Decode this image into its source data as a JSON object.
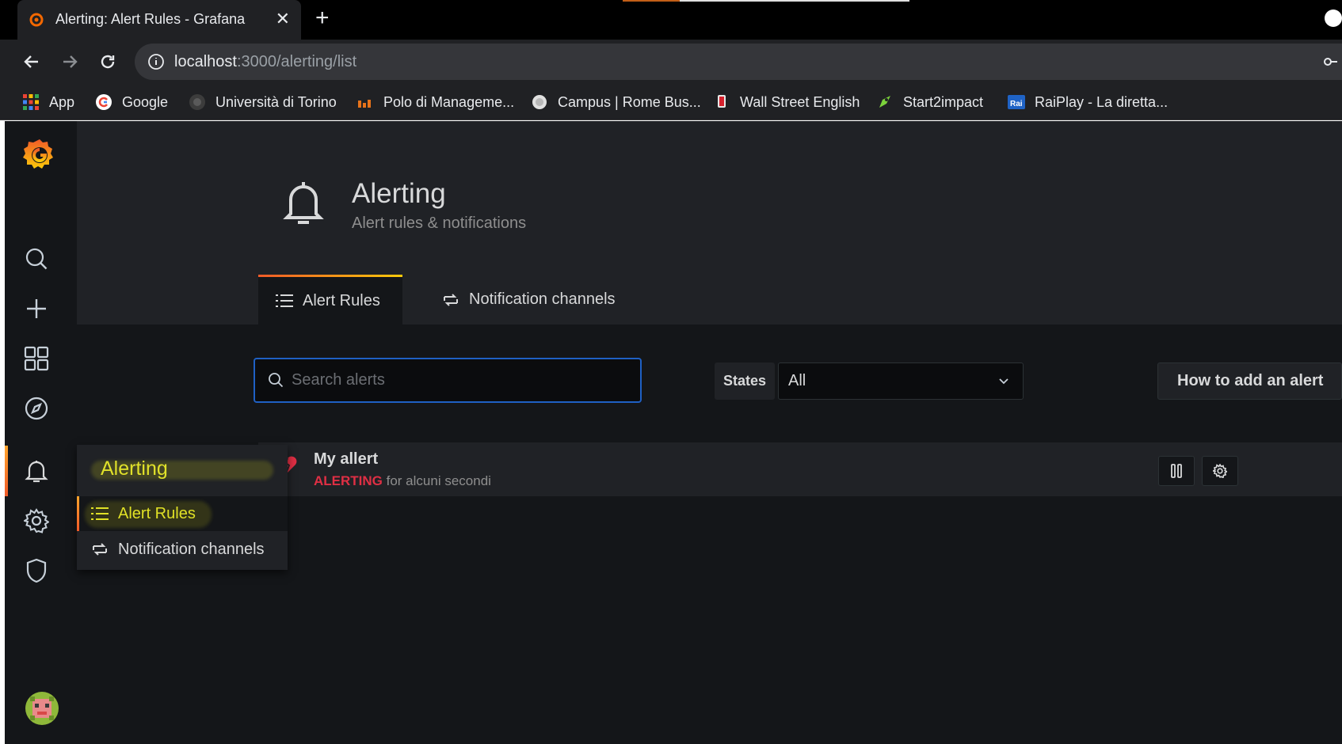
{
  "browser": {
    "tab_title": "Alerting: Alert Rules - Grafana",
    "url_host": "localhost",
    "url_path": ":3000/alerting/list",
    "bookmarks": [
      {
        "label": "App",
        "icon": "apps-grid-icon"
      },
      {
        "label": "Google",
        "icon": "google-icon"
      },
      {
        "label": "Università di Torino",
        "icon": "unito-icon"
      },
      {
        "label": "Polo di Manageme...",
        "icon": "polo-icon"
      },
      {
        "label": "Campus | Rome Bus...",
        "icon": "campus-icon"
      },
      {
        "label": "Wall Street English",
        "icon": "wse-icon"
      },
      {
        "label": "Start2impact",
        "icon": "rocket-icon"
      },
      {
        "label": "RaiPlay - La diretta...",
        "icon": "rai-icon"
      }
    ]
  },
  "sidemenu": {
    "items": [
      "grafana-logo",
      "search-icon",
      "plus-icon",
      "dashboards-icon",
      "explore-icon",
      "alerting-bell-icon",
      "configuration-gear-icon",
      "server-admin-shield-icon"
    ],
    "active": "alerting"
  },
  "submenu": {
    "title": "Alerting",
    "items": [
      {
        "label": "Alert Rules",
        "active": true
      },
      {
        "label": "Notification channels",
        "active": false
      }
    ]
  },
  "header": {
    "title": "Alerting",
    "subtitle": "Alert rules & notifications",
    "tabs": [
      {
        "label": "Alert Rules",
        "active": true
      },
      {
        "label": "Notification channels",
        "active": false
      }
    ]
  },
  "toolbar": {
    "search_placeholder": "Search alerts",
    "states_label": "States",
    "states_value": "All",
    "howto_label": "How to add an alert"
  },
  "rules": [
    {
      "name": "My allert",
      "state": "ALERTING",
      "state_time": "for alcuni secondi",
      "state_color": "#e02f44"
    }
  ],
  "colors": {
    "accent_orange": "#f05a28",
    "accent_yellow": "#fbca0a",
    "focus_blue": "#1f60c4",
    "highlight_yellow": "#e0e12a"
  }
}
